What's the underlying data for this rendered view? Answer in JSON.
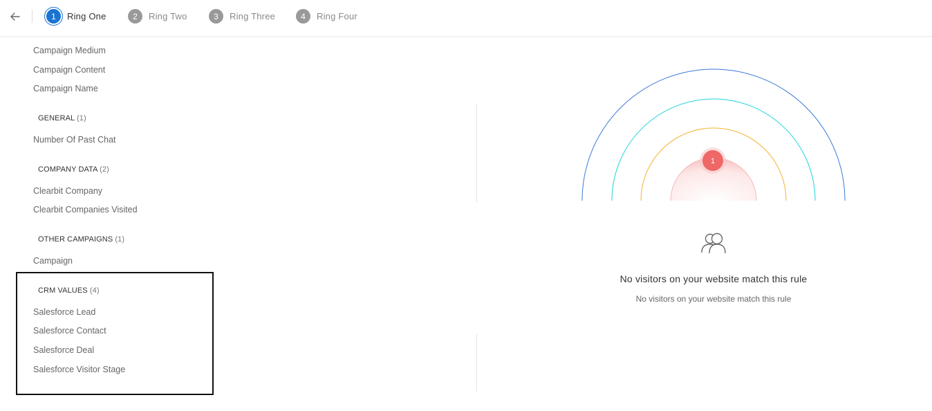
{
  "header": {
    "back_icon": "arrow-left-icon",
    "steps": [
      {
        "number": "1",
        "label": "Ring One",
        "active": true
      },
      {
        "number": "2",
        "label": "Ring Two",
        "active": false
      },
      {
        "number": "3",
        "label": "Ring Three",
        "active": false
      },
      {
        "number": "4",
        "label": "Ring Four",
        "active": false
      }
    ],
    "accent_color": "#1a74d0"
  },
  "sidebar": {
    "campaign_items": [
      "Campaign Medium",
      "Campaign Content",
      "Campaign Name"
    ],
    "groups": [
      {
        "title": "GENERAL",
        "count": "(1)",
        "items": [
          "Number Of Past Chat"
        ]
      },
      {
        "title": "COMPANY DATA",
        "count": "(2)",
        "items": [
          "Clearbit Company",
          "Clearbit Companies Visited"
        ]
      },
      {
        "title": "OTHER CAMPAIGNS",
        "count": "(1)",
        "items": [
          "Campaign"
        ]
      },
      {
        "title": "CRM VALUES",
        "count": "(4)",
        "items": [
          "Salesforce Lead",
          "Salesforce Contact",
          "Salesforce Deal",
          "Salesforce Visitor Stage"
        ]
      }
    ]
  },
  "rings": {
    "badge": "1",
    "colors": {
      "ring_outer": "#3a78d8",
      "ring_second": "#1fd3dc",
      "ring_third": "#f2b431",
      "ring_inner": "#f6b8b8",
      "badge": "#ef6767"
    }
  },
  "empty_state": {
    "icon": "users-icon",
    "title": "No visitors on your website match this rule",
    "subtitle": "No visitors on your website match this rule"
  }
}
